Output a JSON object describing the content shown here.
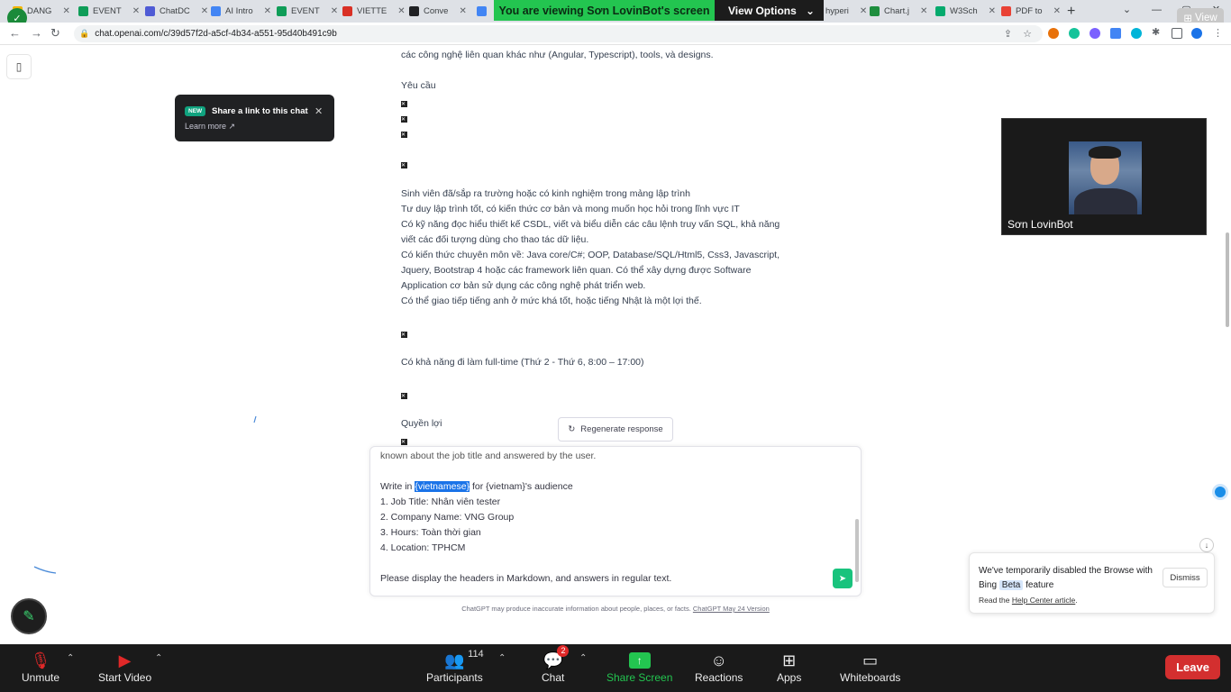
{
  "browser": {
    "tabs": [
      {
        "label": "DANG",
        "color": "#f4b400"
      },
      {
        "label": "EVENT",
        "color": "#0f9d58"
      },
      {
        "label": "ChatDC",
        "color": "#4f5bd5"
      },
      {
        "label": "AI Intro",
        "color": "#4285f4"
      },
      {
        "label": "EVENT",
        "color": "#0f9d58"
      },
      {
        "label": "VIETTE",
        "color": "#d93025"
      },
      {
        "label": "Conve",
        "color": "#202124"
      },
      {
        "label": "hyperi",
        "color": "#4285f4"
      },
      {
        "label": "Chart.j",
        "color": "#1e8e3e"
      },
      {
        "label": "W3Sch",
        "color": "#04aa6d"
      },
      {
        "label": "PDF to",
        "color": "#e94235"
      }
    ],
    "url": "chat.openai.com/c/39d57f2d-a5cf-4b34-a551-95d40b491c9b"
  },
  "screen_share": {
    "viewing_label": "You are viewing Sơn LovinBot's screen",
    "options_label": "View Options",
    "view_label": "View"
  },
  "chat": {
    "tooltip": {
      "badge": "NEW",
      "title": "Share a link to this chat",
      "learn_more": "Learn more"
    },
    "message_lines": [
      "các công nghệ liên quan khác như (Angular, Typescript), tools, và designs.",
      "Yêu cầu",
      "Sinh viên đã/sắp ra trường hoặc có kinh nghiệm trong mảng lập trình",
      "Tư duy lập trình tốt, có kiến thức cơ bản và mong muốn học hỏi trong lĩnh vực IT",
      "Có kỹ năng đọc hiểu thiết kế CSDL, viết và biểu diễn các câu lệnh truy vấn SQL, khả năng",
      "viết các đối tượng dùng cho thao tác dữ liệu.",
      "Có kiến thức chuyên môn về: Java core/C#; OOP, Database/SQL/Html5, Css3, Javascript,",
      "Jquery, Bootstrap 4 hoặc các framework liên quan. Có thể xây dựng được Software",
      "Application cơ bản sử dụng các công nghệ phát triển web.",
      "Có thể giao tiếp tiếng anh ở mức khá tốt, hoặc tiếng Nhật là một lợi thế.",
      "Có khả năng đi làm full-time (Thứ 2 - Thứ 6, 8:00 – 17:00)",
      "Quyền lợi"
    ],
    "regenerate_label": "Regenerate response",
    "input": {
      "cut_line": "known about the job title and answered by the user.",
      "write_prefix": "Write in ",
      "write_highlight": "{vietnamese}",
      "write_suffix": " for {vietnam}'s audience",
      "line1": "1. Job Title: Nhân viên tester",
      "line2": "2. Company Name: VNG Group",
      "line3": "3. Hours: Toàn thời gian",
      "line4": "4. Location: TPHCM",
      "line5": "Please display the headers in Markdown, and answers in regular text."
    },
    "disclaimer": "ChatGPT may produce inaccurate information about people, places, or facts.",
    "disclaimer_link": "ChatGPT May 24 Version"
  },
  "video": {
    "name": "Sơn LovinBot"
  },
  "bing_notice": {
    "text_before": "We've temporarily disabled the Browse with Bing",
    "beta": "Beta",
    "text_after": "feature",
    "read_prefix": "Read the",
    "read_link": "Help Center article",
    "read_suffix": ".",
    "dismiss_label": "Dismiss"
  },
  "zoom_toolbar": {
    "unmute": "Unmute",
    "start_video": "Start Video",
    "participants": "Participants",
    "participants_count": "114",
    "chat": "Chat",
    "chat_badge": "2",
    "share_screen": "Share Screen",
    "reactions": "Reactions",
    "apps": "Apps",
    "whiteboards": "Whiteboards",
    "leave": "Leave"
  },
  "colors": {
    "zoom_green": "#23c550",
    "chatgpt_green": "#19c37d",
    "leave_red": "#d32f2f"
  }
}
